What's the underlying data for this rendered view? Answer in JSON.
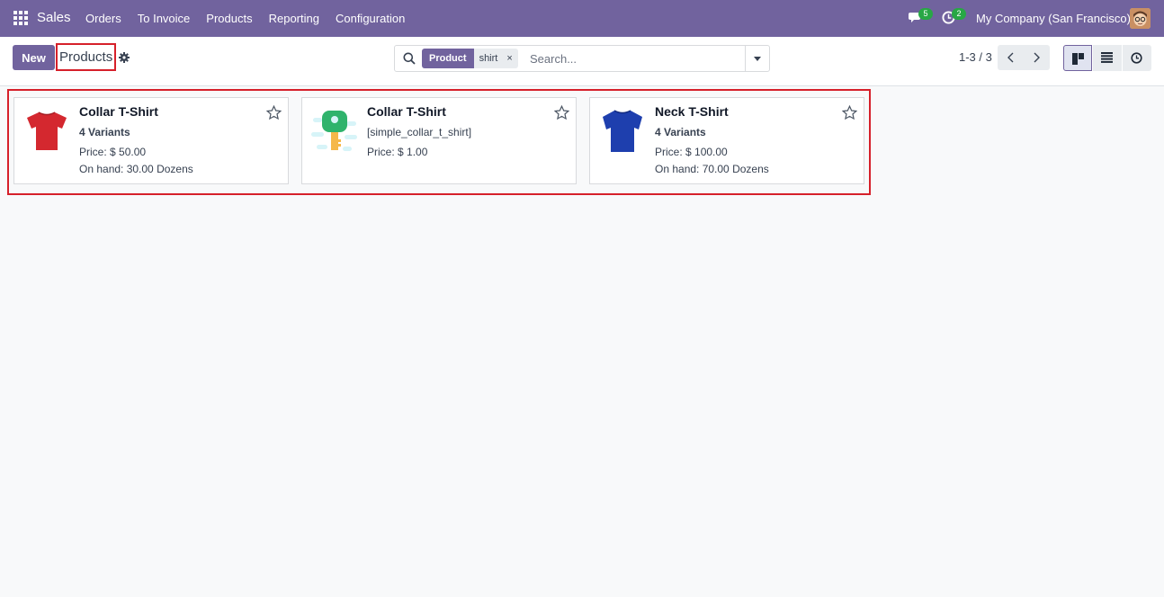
{
  "navbar": {
    "app_name": "Sales",
    "menu": [
      "Orders",
      "To Invoice",
      "Products",
      "Reporting",
      "Configuration"
    ],
    "chat_count": "5",
    "activity_count": "2",
    "company": "My Company (San Francisco)"
  },
  "control": {
    "new_label": "New",
    "breadcrumb": "Products",
    "search": {
      "facet_label": "Product",
      "facet_value": "shirt",
      "facet_remove": "×",
      "placeholder": "Search..."
    },
    "pager": "1-3 / 3"
  },
  "products": [
    {
      "name": "Collar T-Shirt",
      "line1": "4 Variants",
      "line2": "Price: $ 50.00",
      "line3": "On hand: 30.00 Dozens",
      "image": "red-tshirt"
    },
    {
      "name": "Collar T-Shirt",
      "line1": "[simple_collar_t_shirt]",
      "line2": "Price: $ 1.00",
      "line3": "",
      "image": "placeholder-key"
    },
    {
      "name": "Neck T-Shirt",
      "line1": "4 Variants",
      "line2": "Price: $ 100.00",
      "line3": "On hand: 70.00 Dozens",
      "image": "blue-tshirt"
    }
  ],
  "colors": {
    "brand": "#71639e",
    "highlight": "#d6202a",
    "badge": "#28a745"
  }
}
